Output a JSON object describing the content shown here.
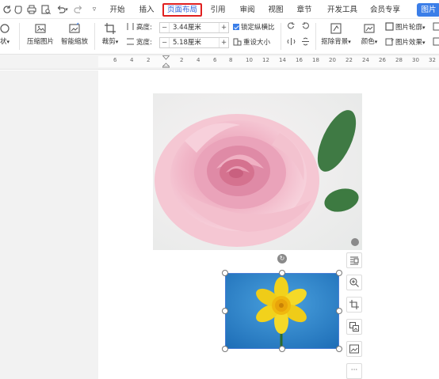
{
  "menubar": {
    "quick_icons": [
      "refresh-icon",
      "save-icon",
      "print-icon",
      "print-preview-icon",
      "undo-icon",
      "redo-icon",
      "more-icon"
    ],
    "tabs": [
      {
        "label": "开始"
      },
      {
        "label": "插入"
      },
      {
        "label": "页面布局",
        "active": true
      },
      {
        "label": "引用"
      },
      {
        "label": "审阅"
      },
      {
        "label": "视图"
      },
      {
        "label": "章节"
      },
      {
        "label": "开发工具"
      },
      {
        "label": "会员专享"
      },
      {
        "label": "图片"
      }
    ],
    "active_highlight_color": "#e02020",
    "context_tab_color": "#3b7ee8"
  },
  "ribbon": {
    "shape_label": "状",
    "compress_label": "压缩图片",
    "smart_zoom_label": "智能缩放",
    "crop_label": "裁剪",
    "height_label": "高度:",
    "height_value": "3.44厘米",
    "width_label": "宽度:",
    "width_value": "5.18厘米",
    "lock_ratio_label": "锁定纵横比",
    "reset_size_label": "重设大小",
    "remove_bg_label": "抠除背景",
    "color_label": "颜色",
    "outline_label": "图片轮廓",
    "effect_label": "图片效果",
    "minus": "−",
    "plus": "+"
  },
  "ruler": {
    "ticks": [
      "6",
      "4",
      "2",
      "2",
      "4",
      "6",
      "8",
      "10",
      "12",
      "14",
      "16",
      "18",
      "20",
      "22",
      "24",
      "26",
      "28",
      "30",
      "32"
    ]
  },
  "document": {
    "images": [
      "rose-image",
      "daffodil-image"
    ],
    "selection_color": "#4a7fd6",
    "side_tools": [
      "layout-options-icon",
      "zoom-icon",
      "crop-icon",
      "replace-image-icon",
      "image-tool-icon",
      "more-icon"
    ],
    "more_label": "···"
  }
}
